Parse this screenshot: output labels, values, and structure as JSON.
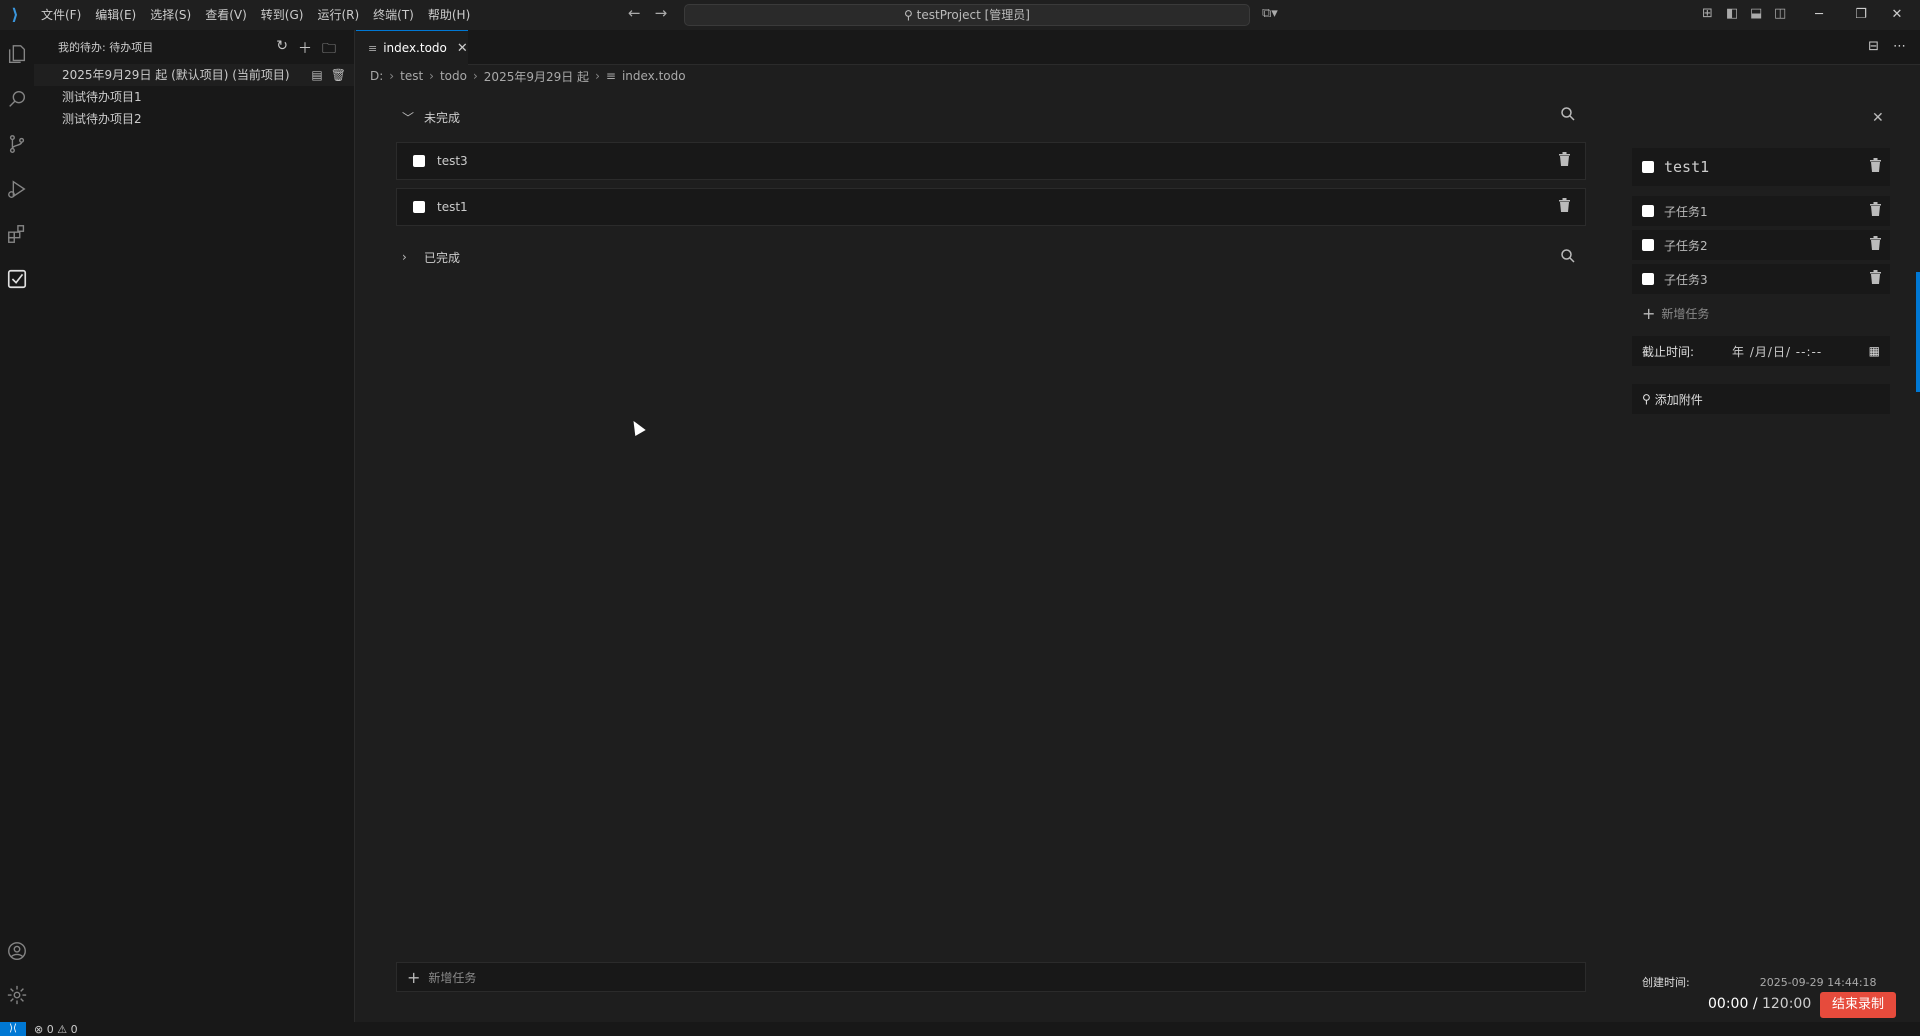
{
  "titlebar": {
    "menu": [
      "文件(F)",
      "编辑(E)",
      "选择(S)",
      "查看(V)",
      "转到(G)",
      "运行(R)",
      "终端(T)",
      "帮助(H)"
    ],
    "search_text": "testProject [管理员]"
  },
  "sidebar": {
    "header": "我的待办: 待办项目",
    "projects": [
      "2025年9月29日 起 (默认项目) (当前项目)",
      "测试待办项目1",
      "测试待办项目2"
    ]
  },
  "tab": {
    "label": "index.todo"
  },
  "breadcrumb": [
    "D:",
    "test",
    "todo",
    "2025年9月29日 起",
    "index.todo"
  ],
  "sections": {
    "incomplete": "未完成",
    "completed": "已完成"
  },
  "tasks": [
    "test3",
    "test1"
  ],
  "add_task_placeholder": "新增任务",
  "detail": {
    "title": "test1",
    "subtasks": [
      "子任务1",
      "子任务2",
      "子任务3"
    ],
    "add_subtask": "新增任务",
    "deadline_label": "截止时间:",
    "deadline_value": "年 /月/日/ --:--",
    "attach_label": "添加附件",
    "created_label": "创建时间:",
    "created_value": "2025-09-29 14:44:18"
  },
  "statusbar": {
    "errors": "0",
    "warnings": "0"
  },
  "recording": {
    "elapsed": "00:00",
    "total": "120:00",
    "stop_label": "结束录制"
  },
  "colors": {
    "accent": "#0078d4",
    "record": "#e64b3c"
  }
}
